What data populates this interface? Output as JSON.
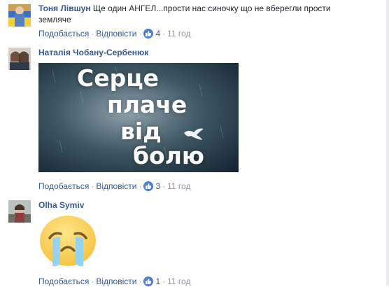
{
  "comments": [
    {
      "author": "Тоня Лівшун",
      "text": "Ще один АНГЕЛ...прости нас синочку що не вберегли прости",
      "text_line2": "земляче",
      "like_label": "Подобається",
      "reply_label": "Відповісти",
      "likes": "4",
      "time": "11 год"
    },
    {
      "author": "Наталія Чобану-Сербенюк",
      "image_lines": [
        "Серце",
        "плаче",
        "від",
        "болю ..."
      ],
      "like_label": "Подобається",
      "reply_label": "Відповісти",
      "likes": "3",
      "time": "11 год"
    },
    {
      "author": "Olha Symiv",
      "sticker": "crying-face-sticker",
      "like_label": "Подобається",
      "reply_label": "Відповісти",
      "likes": "1",
      "time": "11 год"
    }
  ],
  "colors": {
    "link": "#365899",
    "meta": "#90949c",
    "like_badge": "#4b7ddb"
  }
}
